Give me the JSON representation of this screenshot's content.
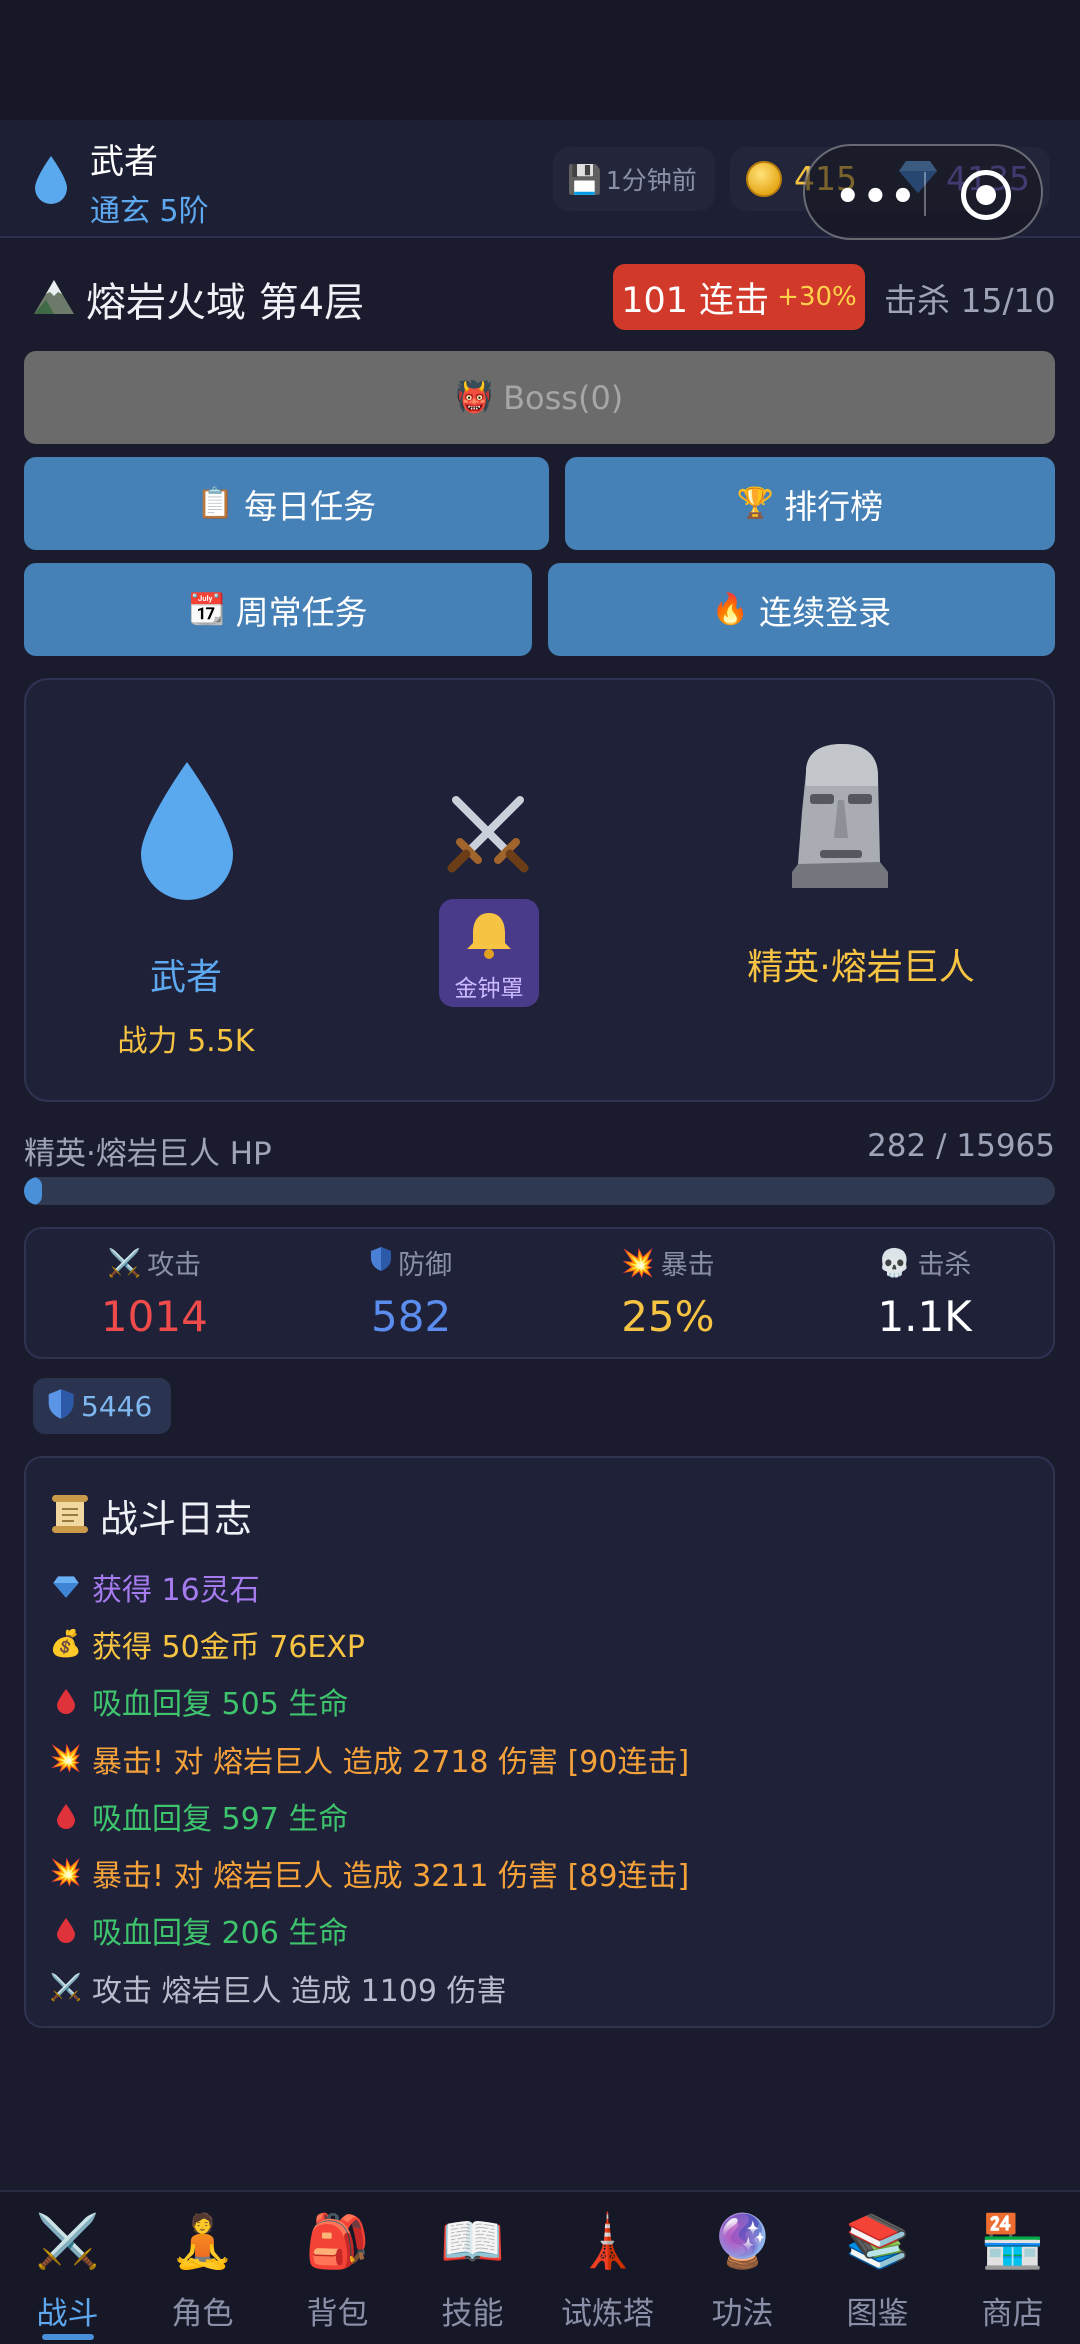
{
  "header": {
    "player_name": "武者",
    "realm": "通玄 5阶",
    "save_status": "1分钟前",
    "gold": "415",
    "gems": "4135"
  },
  "zone": {
    "title": "熔岩火域 第4层",
    "combo": "101 连击",
    "combo_bonus": "+30%",
    "kills": "击杀 15/10"
  },
  "buttons": {
    "boss": "Boss(0)",
    "daily": "每日任务",
    "ranking": "排行榜",
    "weekly": "周常任务",
    "login_streak": "连续登录"
  },
  "battle": {
    "player_name": "武者",
    "player_power": "战力 5.5K",
    "skill_name": "金钟罩",
    "enemy_name": "精英·熔岩巨人"
  },
  "hp": {
    "label": "精英·熔岩巨人 HP",
    "value": "282 / 15965",
    "current": 282,
    "max": 15965
  },
  "stats": [
    {
      "label": "攻击",
      "value": "1014",
      "icon": "swords-icon",
      "color": "#ef4b4b"
    },
    {
      "label": "防御",
      "value": "582",
      "icon": "shield-icon",
      "color": "#5b8def"
    },
    {
      "label": "暴击",
      "value": "25%",
      "icon": "burst-icon",
      "color": "#f6c342"
    },
    {
      "label": "击杀",
      "value": "1.1K",
      "icon": "skull-icon",
      "color": "#ffffff"
    }
  ],
  "shield_value": "5446",
  "log": {
    "title": "战斗日志",
    "entries": [
      {
        "icon": "gem",
        "text": "获得 16灵石",
        "color": "#a77bf0"
      },
      {
        "icon": "moneybag",
        "text": "获得 50金币 76EXP",
        "color": "#f6c342"
      },
      {
        "icon": "blood",
        "text": "吸血回复 505 生命",
        "color": "#3ec46d"
      },
      {
        "icon": "burst",
        "text": "暴击! 对 熔岩巨人 造成 2718 伤害 [90连击]",
        "color": "#f6a23a"
      },
      {
        "icon": "blood",
        "text": "吸血回复 597 生命",
        "color": "#3ec46d"
      },
      {
        "icon": "burst",
        "text": "暴击! 对 熔岩巨人 造成 3211 伤害 [89连击]",
        "color": "#f6a23a"
      },
      {
        "icon": "blood",
        "text": "吸血回复 206 生命",
        "color": "#3ec46d"
      },
      {
        "icon": "swords",
        "text": "攻击 熔岩巨人 造成 1109 伤害",
        "color": "#b8bccc"
      }
    ]
  },
  "nav": [
    {
      "label": "战斗",
      "icon": "swords-icon",
      "active": true
    },
    {
      "label": "角色",
      "icon": "meditate-icon",
      "active": false
    },
    {
      "label": "背包",
      "icon": "backpack-icon",
      "active": false
    },
    {
      "label": "技能",
      "icon": "book-icon",
      "active": false
    },
    {
      "label": "试炼塔",
      "icon": "tower-icon",
      "active": false
    },
    {
      "label": "功法",
      "icon": "crystal-ball-icon",
      "active": false
    },
    {
      "label": "图鉴",
      "icon": "books-icon",
      "active": false
    },
    {
      "label": "商店",
      "icon": "store-icon",
      "active": false
    }
  ]
}
